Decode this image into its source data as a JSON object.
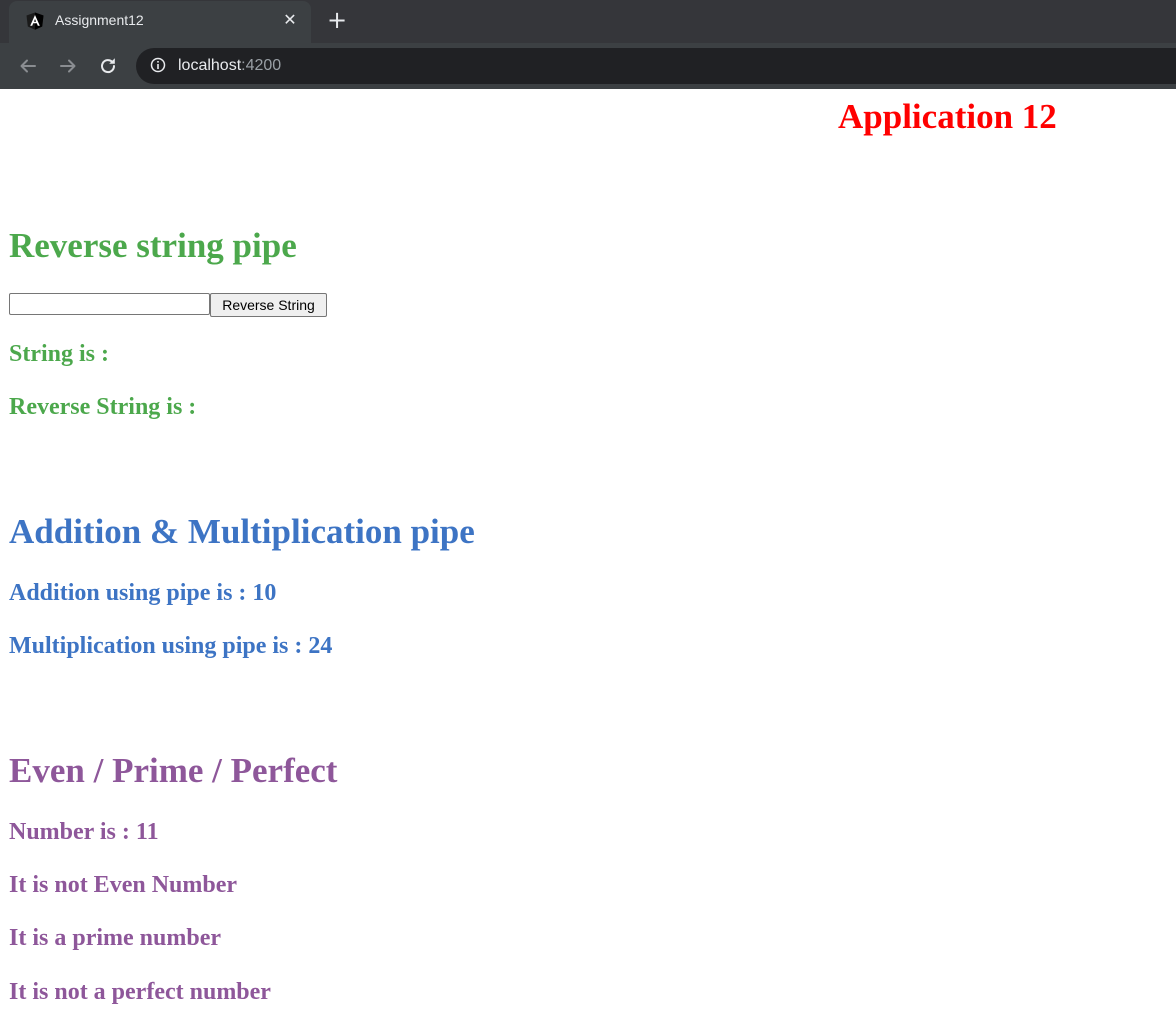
{
  "browser": {
    "tab_title": "Assignment12",
    "close_glyph": "✕",
    "new_tab_glyph": "+",
    "url_host": "localhost",
    "url_port": ":4200"
  },
  "page": {
    "app_title": "Application 12",
    "reverse": {
      "heading": "Reverse string pipe",
      "input_value": "",
      "button_label": "Reverse String",
      "string_label": "String is :",
      "reverse_label": "Reverse String is :"
    },
    "arith": {
      "heading": "Addition & Multiplication pipe",
      "addition": "Addition using pipe is : 10",
      "multiplication": "Multiplication using pipe is : 24"
    },
    "number": {
      "heading": "Even / Prime / Perfect",
      "number_line": "Number is : 11",
      "even_line": "It is not Even Number",
      "prime_line": "It is a prime number",
      "perfect_line": "It is not a perfect number"
    }
  },
  "colors": {
    "title": "#ff0000",
    "green": "#4ca84c",
    "blue": "#3d74c4",
    "purple": "#8e579a"
  },
  "icons": [
    "angular-icon",
    "close-icon",
    "plus-icon",
    "back-arrow-icon",
    "forward-arrow-icon",
    "reload-icon",
    "info-icon"
  ]
}
